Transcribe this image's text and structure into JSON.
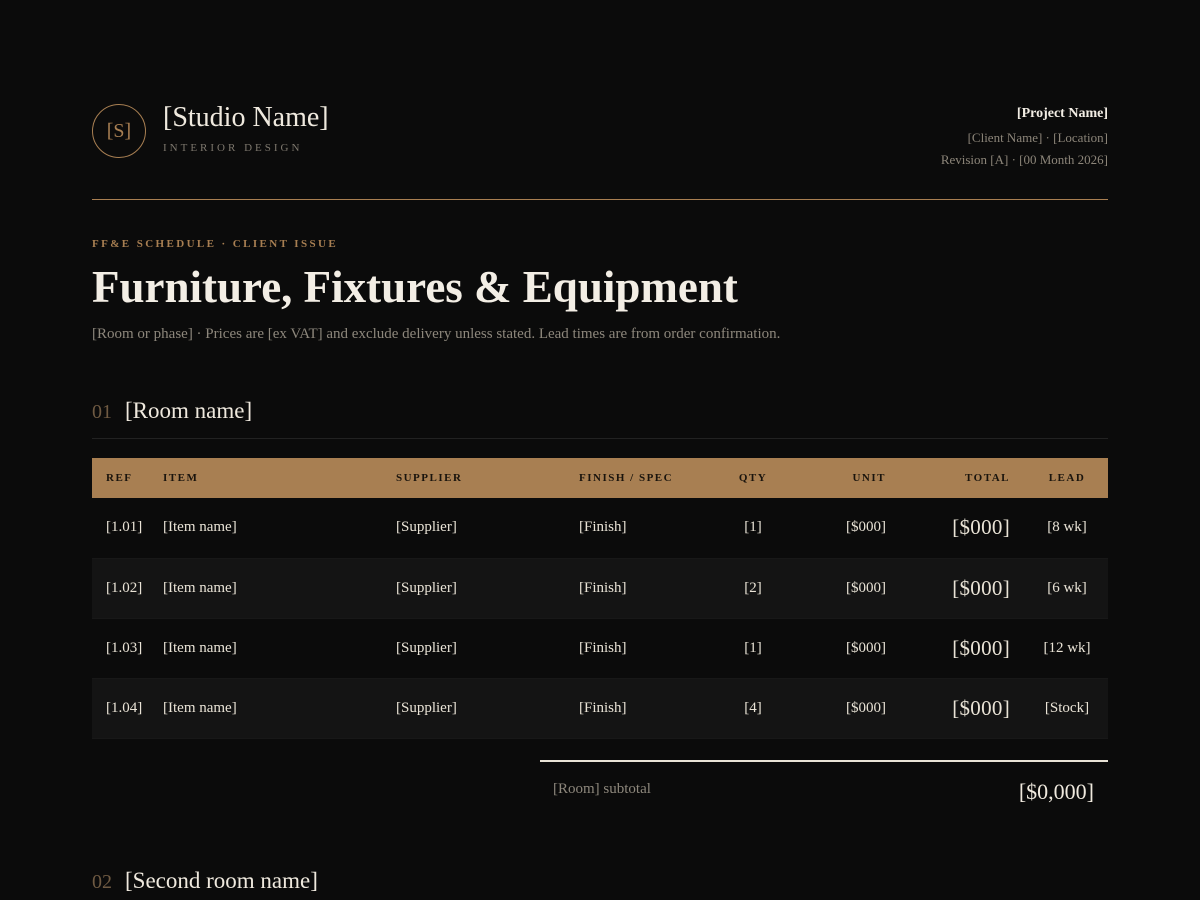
{
  "studio": {
    "monogram": "[S]",
    "name": "[Studio Name]",
    "subtitle": "INTERIOR DESIGN"
  },
  "project": {
    "name": "[Project Name]",
    "client_location": "[Client Name] · [Location]",
    "revision": "Revision [A] · [00 Month 2026]"
  },
  "document": {
    "eyebrow": "FF&E SCHEDULE · CLIENT ISSUE",
    "title": "Furniture, Fixtures & Equipment",
    "description": "[Room or phase] · Prices are [ex VAT] and exclude delivery unless stated. Lead times are from order confirmation."
  },
  "sections": [
    {
      "number": "01",
      "name": "[Room name]",
      "columns": [
        "REF",
        "ITEM",
        "SUPPLIER",
        "FINISH / SPEC",
        "QTY",
        "UNIT",
        "TOTAL",
        "LEAD"
      ],
      "rows": [
        {
          "ref": "[1.01]",
          "item": "[Item name]",
          "supplier": "[Supplier]",
          "finish": "[Finish]",
          "qty": "[1]",
          "unit": "[$000]",
          "total": "[$000]",
          "lead": "[8 wk]"
        },
        {
          "ref": "[1.02]",
          "item": "[Item name]",
          "supplier": "[Supplier]",
          "finish": "[Finish]",
          "qty": "[2]",
          "unit": "[$000]",
          "total": "[$000]",
          "lead": "[6 wk]"
        },
        {
          "ref": "[1.03]",
          "item": "[Item name]",
          "supplier": "[Supplier]",
          "finish": "[Finish]",
          "qty": "[1]",
          "unit": "[$000]",
          "total": "[$000]",
          "lead": "[12 wk]"
        },
        {
          "ref": "[1.04]",
          "item": "[Item name]",
          "supplier": "[Supplier]",
          "finish": "[Finish]",
          "qty": "[4]",
          "unit": "[$000]",
          "total": "[$000]",
          "lead": "[Stock]"
        }
      ],
      "subtotal_label": "[Room] subtotal",
      "subtotal_value": "[$0,000]"
    },
    {
      "number": "02",
      "name": "[Second room name]"
    }
  ],
  "colors": {
    "accent": "#a87f52",
    "background": "#0b0b0b",
    "text": "#e9e3d6",
    "muted": "#8d877c"
  }
}
